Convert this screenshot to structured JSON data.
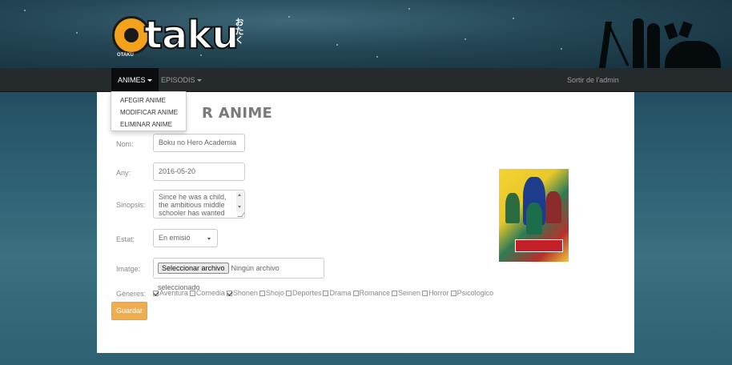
{
  "header": {
    "logo_text": "taku",
    "logo_kana": "おたく",
    "logo_sub": "OTAKU"
  },
  "navbar": {
    "animes_label": "ANIMES",
    "episodis_label": "EPISODIS",
    "logout_label": "Sortir de l'admin"
  },
  "dropdown": {
    "items": [
      "AFEGIR ANIME",
      "MODIFICAR ANIME",
      "ELIMINAR ANIME"
    ]
  },
  "form": {
    "title": "R ANIME",
    "nom_label": "Nom:",
    "nom_value": "Boku no Hero Academia",
    "any_label": "Any:",
    "any_value": "2016-05-20",
    "sinopsis_label": "Sinopsis:",
    "sinopsis_value": "Since he was a child, the ambitious middle schooler has wanted",
    "estat_label": "Estat:",
    "estat_value": "En emisió",
    "imatge_label": "Imatge:",
    "file_button": "Seleccionar archivo",
    "file_status": "Ningún archivo seleccionado",
    "generes_label": "Gèneres:",
    "genres": [
      {
        "name": "Aventura",
        "checked": true
      },
      {
        "name": "Comedia",
        "checked": false
      },
      {
        "name": "Shonen",
        "checked": true
      },
      {
        "name": "Shojo",
        "checked": false
      },
      {
        "name": "Deportes",
        "checked": false
      },
      {
        "name": "Drama",
        "checked": false
      },
      {
        "name": "Romance",
        "checked": false
      },
      {
        "name": "Seinen",
        "checked": false
      },
      {
        "name": "Horror",
        "checked": false
      },
      {
        "name": "Psicologico",
        "checked": false
      }
    ],
    "save_label": "Guardar"
  },
  "colors": {
    "accent": "#f0ad4e",
    "navbar": "#252a2d",
    "logo_orange": "#f4a21e"
  }
}
